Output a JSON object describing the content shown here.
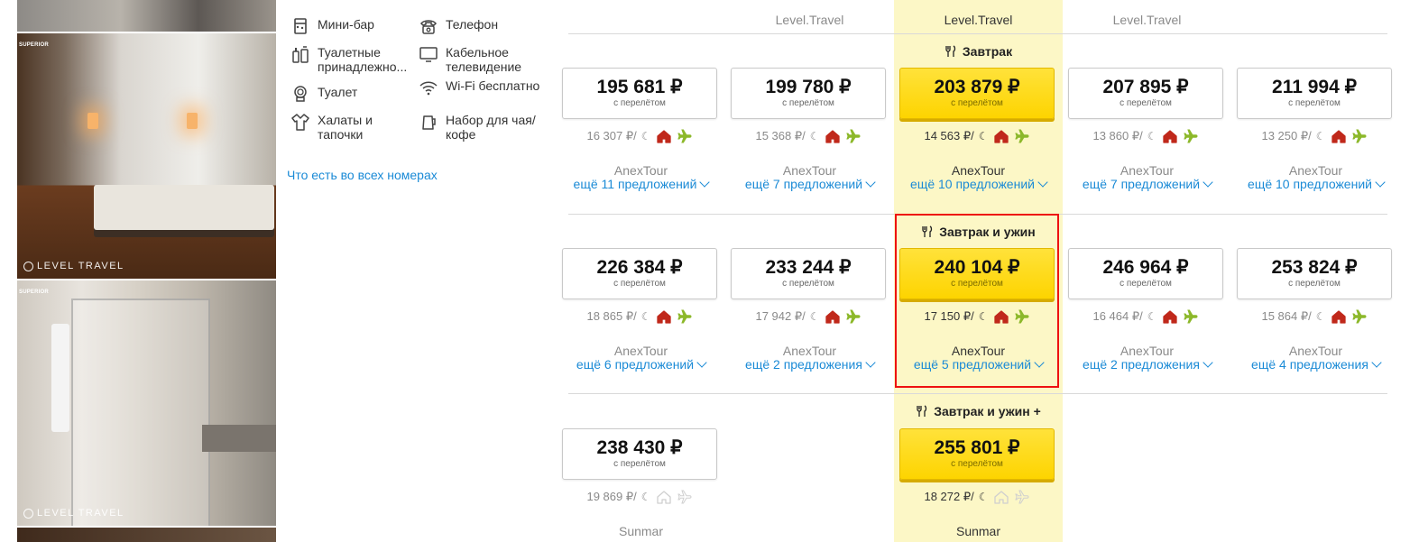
{
  "photos": [
    {
      "badge": "",
      "watermark": ""
    },
    {
      "badge": "SUPERIOR",
      "watermark": "LEVEL TRAVEL"
    },
    {
      "badge": "SUPERIOR",
      "watermark": "LEVEL TRAVEL"
    }
  ],
  "amenities": [
    {
      "label": "Мини-бар",
      "icon": "minibar-icon"
    },
    {
      "label": "Телефон",
      "icon": "phone-icon"
    },
    {
      "label": "Туалетные принадлежно...",
      "icon": "toiletries-icon"
    },
    {
      "label": "Кабельное телевидение",
      "icon": "tv-icon"
    },
    {
      "label": "Туалет",
      "icon": "toilet-icon"
    },
    {
      "label": "Wi-Fi бесплатно",
      "icon": "wifi-icon"
    },
    {
      "label": "Халаты и тапочки",
      "icon": "bathrobe-icon"
    },
    {
      "label": "Набор для чая/кофе",
      "icon": "kettle-icon"
    }
  ],
  "all_rooms_link": "Что есть во всех номерах",
  "operator_headers": [
    "Level.Travel",
    "Level.Travel",
    "Level.Travel"
  ],
  "price_note": "с перелётом",
  "colors": {
    "accent_yellow": "#fdd400",
    "highlight_column": "#fcf7c6",
    "link_blue": "#1a8ad6",
    "hotel_icon_red": "#c0281b",
    "plane_icon_green": "#8cb82a",
    "selection_border": "#e11111"
  },
  "boards": [
    {
      "name": "Завтрак",
      "offers": [
        {
          "price": "195 681 ₽",
          "per_night": "16 307 ₽/",
          "operator": "AnexTour",
          "more": "ещё 11 предложений"
        },
        {
          "price": "199 780 ₽",
          "per_night": "15 368 ₽/",
          "operator": "AnexTour",
          "more": "ещё 7 предложений"
        },
        {
          "price": "203 879 ₽",
          "per_night": "14 563 ₽/",
          "operator": "AnexTour",
          "more": "ещё 10 предложений"
        },
        {
          "price": "207 895 ₽",
          "per_night": "13 860 ₽/",
          "operator": "AnexTour",
          "more": "ещё 7 предложений"
        },
        {
          "price": "211 994 ₽",
          "per_night": "13 250 ₽/",
          "operator": "AnexTour",
          "more": "ещё 10 предложений"
        }
      ]
    },
    {
      "name": "Завтрак и ужин",
      "offers": [
        {
          "price": "226 384 ₽",
          "per_night": "18 865 ₽/",
          "operator": "AnexTour",
          "more": "ещё 6 предложений"
        },
        {
          "price": "233 244 ₽",
          "per_night": "17 942 ₽/",
          "operator": "AnexTour",
          "more": "ещё 2 предложения"
        },
        {
          "price": "240 104 ₽",
          "per_night": "17 150 ₽/",
          "operator": "AnexTour",
          "more": "ещё 5 предложений"
        },
        {
          "price": "246 964 ₽",
          "per_night": "16 464 ₽/",
          "operator": "AnexTour",
          "more": "ещё 2 предложения"
        },
        {
          "price": "253 824 ₽",
          "per_night": "15 864 ₽/",
          "operator": "AnexTour",
          "more": "ещё 4 предложения"
        }
      ]
    },
    {
      "name": "Завтрак и ужин +",
      "offers": [
        {
          "price": "238 430 ₽",
          "per_night": "19 869 ₽/",
          "operator": "Sunmar",
          "more": ""
        },
        null,
        {
          "price": "255 801 ₽",
          "per_night": "18 272 ₽/",
          "operator": "Sunmar",
          "more": ""
        },
        null,
        null
      ]
    }
  ]
}
